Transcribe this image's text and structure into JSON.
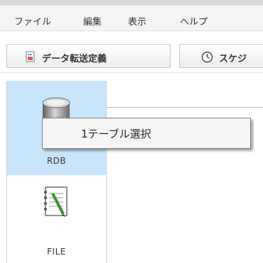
{
  "menubar": {
    "items": [
      {
        "label": "ファイル"
      },
      {
        "label": "編集"
      },
      {
        "label": "表示"
      },
      {
        "label": "ヘルプ"
      }
    ]
  },
  "toolbar": {
    "tabs": [
      {
        "label": "データ転送定義",
        "icon": "document-icon"
      },
      {
        "label": "スケジ",
        "icon": "clock-icon"
      }
    ]
  },
  "sidebar": {
    "items": [
      {
        "label": "RDB",
        "icon": "database-icon",
        "selected": true
      },
      {
        "label": "FILE",
        "icon": "notebook-icon",
        "selected": false
      }
    ]
  },
  "context_menu": {
    "items": [
      {
        "label": "1テーブル選択"
      }
    ]
  },
  "colors": {
    "selected_bg": "#c8e6fb",
    "menubar_bg": "#f4f4f4"
  }
}
